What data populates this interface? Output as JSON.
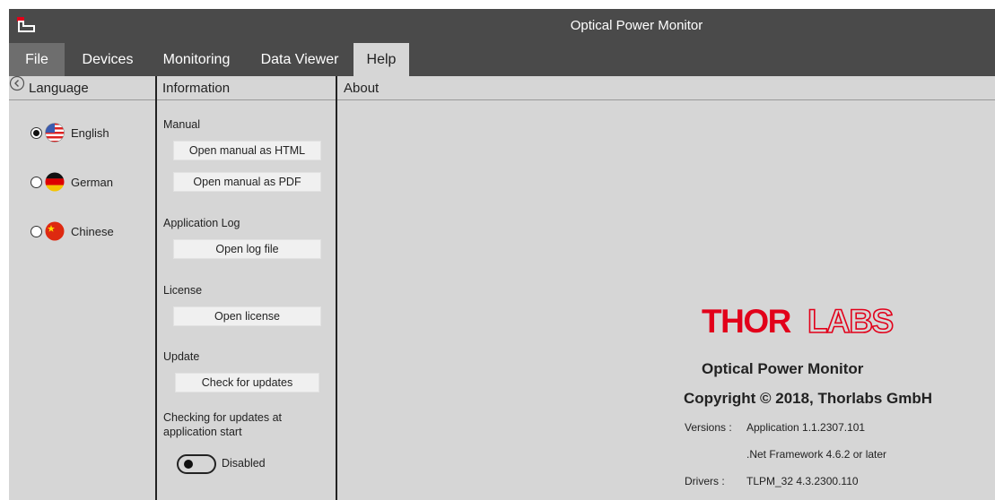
{
  "window": {
    "title": "Optical Power Monitor"
  },
  "menu": {
    "file": "File",
    "devices": "Devices",
    "monitoring": "Monitoring",
    "data_viewer": "Data Viewer",
    "help": "Help"
  },
  "language": {
    "header": "Language",
    "options": [
      {
        "label": "English",
        "selected": true,
        "flag": "us-flag-icon"
      },
      {
        "label": "German",
        "selected": false,
        "flag": "de-flag-icon"
      },
      {
        "label": "Chinese",
        "selected": false,
        "flag": "cn-flag-icon"
      }
    ]
  },
  "information": {
    "header": "Information",
    "manual_label": "Manual",
    "open_html": "Open manual as HTML",
    "open_pdf": "Open manual as PDF",
    "applog_label": "Application Log",
    "open_log": "Open log file",
    "license_label": "License",
    "open_license": "Open license",
    "update_label": "Update",
    "check_updates": "Check for updates",
    "startup_check_label": "Checking for updates at application start",
    "startup_check_state": "Disabled"
  },
  "about": {
    "header": "About",
    "logo_text": "THORLABS",
    "product": "Optical Power Monitor",
    "copyright": "Copyright © 2018, Thorlabs GmbH",
    "versions_label": "Versions",
    "application_version": "Application 1.1.2307.101",
    "framework_version": ".Net Framework 4.6.2 or later",
    "drivers_label": "Drivers",
    "drivers_version": "TLPM_32 4.3.2300.110"
  },
  "colors": {
    "titlebar": "#4a4a4a",
    "background": "#d6d6d6",
    "brand_red": "#e2001a"
  }
}
